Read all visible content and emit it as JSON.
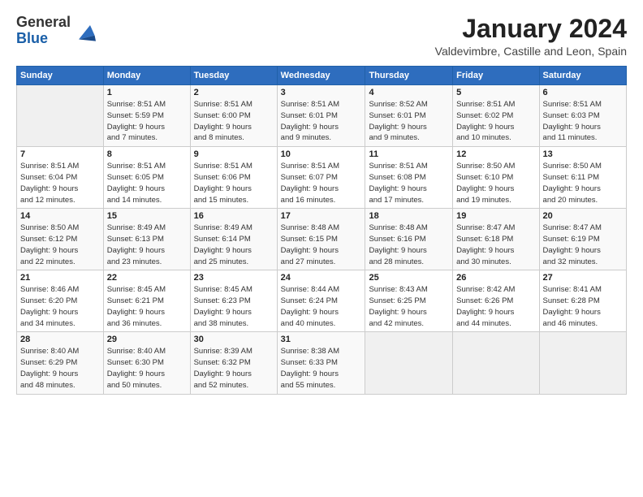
{
  "logo": {
    "line1": "General",
    "line2": "Blue"
  },
  "title": "January 2024",
  "location": "Valdevimbre, Castille and Leon, Spain",
  "headers": [
    "Sunday",
    "Monday",
    "Tuesday",
    "Wednesday",
    "Thursday",
    "Friday",
    "Saturday"
  ],
  "weeks": [
    [
      {
        "day": "",
        "info": ""
      },
      {
        "day": "1",
        "info": "Sunrise: 8:51 AM\nSunset: 5:59 PM\nDaylight: 9 hours\nand 7 minutes."
      },
      {
        "day": "2",
        "info": "Sunrise: 8:51 AM\nSunset: 6:00 PM\nDaylight: 9 hours\nand 8 minutes."
      },
      {
        "day": "3",
        "info": "Sunrise: 8:51 AM\nSunset: 6:01 PM\nDaylight: 9 hours\nand 9 minutes."
      },
      {
        "day": "4",
        "info": "Sunrise: 8:52 AM\nSunset: 6:01 PM\nDaylight: 9 hours\nand 9 minutes."
      },
      {
        "day": "5",
        "info": "Sunrise: 8:51 AM\nSunset: 6:02 PM\nDaylight: 9 hours\nand 10 minutes."
      },
      {
        "day": "6",
        "info": "Sunrise: 8:51 AM\nSunset: 6:03 PM\nDaylight: 9 hours\nand 11 minutes."
      }
    ],
    [
      {
        "day": "7",
        "info": "Sunrise: 8:51 AM\nSunset: 6:04 PM\nDaylight: 9 hours\nand 12 minutes."
      },
      {
        "day": "8",
        "info": "Sunrise: 8:51 AM\nSunset: 6:05 PM\nDaylight: 9 hours\nand 14 minutes."
      },
      {
        "day": "9",
        "info": "Sunrise: 8:51 AM\nSunset: 6:06 PM\nDaylight: 9 hours\nand 15 minutes."
      },
      {
        "day": "10",
        "info": "Sunrise: 8:51 AM\nSunset: 6:07 PM\nDaylight: 9 hours\nand 16 minutes."
      },
      {
        "day": "11",
        "info": "Sunrise: 8:51 AM\nSunset: 6:08 PM\nDaylight: 9 hours\nand 17 minutes."
      },
      {
        "day": "12",
        "info": "Sunrise: 8:50 AM\nSunset: 6:10 PM\nDaylight: 9 hours\nand 19 minutes."
      },
      {
        "day": "13",
        "info": "Sunrise: 8:50 AM\nSunset: 6:11 PM\nDaylight: 9 hours\nand 20 minutes."
      }
    ],
    [
      {
        "day": "14",
        "info": "Sunrise: 8:50 AM\nSunset: 6:12 PM\nDaylight: 9 hours\nand 22 minutes."
      },
      {
        "day": "15",
        "info": "Sunrise: 8:49 AM\nSunset: 6:13 PM\nDaylight: 9 hours\nand 23 minutes."
      },
      {
        "day": "16",
        "info": "Sunrise: 8:49 AM\nSunset: 6:14 PM\nDaylight: 9 hours\nand 25 minutes."
      },
      {
        "day": "17",
        "info": "Sunrise: 8:48 AM\nSunset: 6:15 PM\nDaylight: 9 hours\nand 27 minutes."
      },
      {
        "day": "18",
        "info": "Sunrise: 8:48 AM\nSunset: 6:16 PM\nDaylight: 9 hours\nand 28 minutes."
      },
      {
        "day": "19",
        "info": "Sunrise: 8:47 AM\nSunset: 6:18 PM\nDaylight: 9 hours\nand 30 minutes."
      },
      {
        "day": "20",
        "info": "Sunrise: 8:47 AM\nSunset: 6:19 PM\nDaylight: 9 hours\nand 32 minutes."
      }
    ],
    [
      {
        "day": "21",
        "info": "Sunrise: 8:46 AM\nSunset: 6:20 PM\nDaylight: 9 hours\nand 34 minutes."
      },
      {
        "day": "22",
        "info": "Sunrise: 8:45 AM\nSunset: 6:21 PM\nDaylight: 9 hours\nand 36 minutes."
      },
      {
        "day": "23",
        "info": "Sunrise: 8:45 AM\nSunset: 6:23 PM\nDaylight: 9 hours\nand 38 minutes."
      },
      {
        "day": "24",
        "info": "Sunrise: 8:44 AM\nSunset: 6:24 PM\nDaylight: 9 hours\nand 40 minutes."
      },
      {
        "day": "25",
        "info": "Sunrise: 8:43 AM\nSunset: 6:25 PM\nDaylight: 9 hours\nand 42 minutes."
      },
      {
        "day": "26",
        "info": "Sunrise: 8:42 AM\nSunset: 6:26 PM\nDaylight: 9 hours\nand 44 minutes."
      },
      {
        "day": "27",
        "info": "Sunrise: 8:41 AM\nSunset: 6:28 PM\nDaylight: 9 hours\nand 46 minutes."
      }
    ],
    [
      {
        "day": "28",
        "info": "Sunrise: 8:40 AM\nSunset: 6:29 PM\nDaylight: 9 hours\nand 48 minutes."
      },
      {
        "day": "29",
        "info": "Sunrise: 8:40 AM\nSunset: 6:30 PM\nDaylight: 9 hours\nand 50 minutes."
      },
      {
        "day": "30",
        "info": "Sunrise: 8:39 AM\nSunset: 6:32 PM\nDaylight: 9 hours\nand 52 minutes."
      },
      {
        "day": "31",
        "info": "Sunrise: 8:38 AM\nSunset: 6:33 PM\nDaylight: 9 hours\nand 55 minutes."
      },
      {
        "day": "",
        "info": ""
      },
      {
        "day": "",
        "info": ""
      },
      {
        "day": "",
        "info": ""
      }
    ]
  ]
}
